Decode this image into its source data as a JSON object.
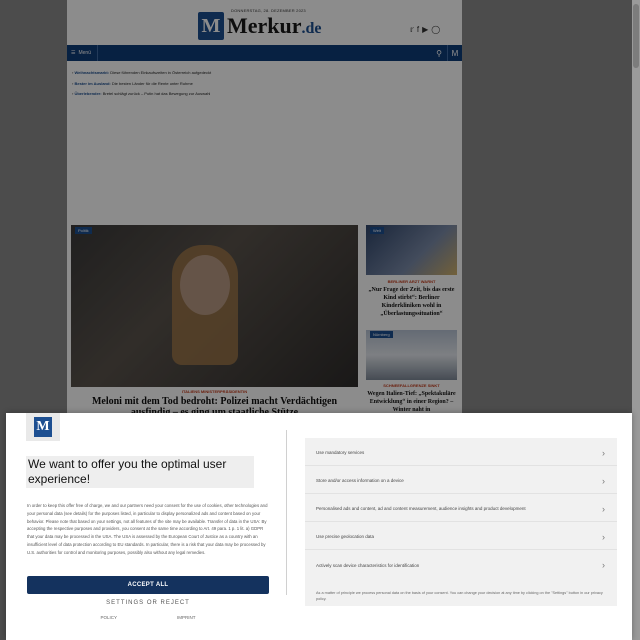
{
  "header": {
    "date": "DONNERSTAG, 28. DEZEMBER 2023",
    "logo_mark": "M",
    "logo_name": "Merkur",
    "logo_tld": ".de",
    "social_icons": [
      "twitter-icon",
      "facebook-icon",
      "youtube-icon",
      "instagram-icon"
    ]
  },
  "nav": {
    "menu_label": "Menü"
  },
  "tickers": [
    {
      "kicker": "Weihnachtsmarkt:",
      "text": "Diese führenden Einkaufszeiten in Österreich aufgedeckt"
    },
    {
      "kicker": "Bester im Ausland:",
      "text": "Die besten Länder für die Rente unter Ruhme"
    },
    {
      "kicker": "Überlebender:",
      "text": "Bretel schlägt zurück – Putin hat das Bewegung zur Auswahl"
    }
  ],
  "hero": {
    "tag": "Politik",
    "kicker": "ITALIENS MINISTERPRÄSIDENTIN",
    "title": "Meloni mit dem Tod bedroht: Polizei macht Verdächtigen ausfindig – es ging um staatliche Stütze"
  },
  "side_articles": [
    {
      "tag": "Welt",
      "kicker": "BERLINER ARZT WARNT",
      "title": "„Nur Frage der Zeit, bis das erste Kind stirbt“: Berliner Kinderkliniken wohl in „Überlastungssituation“"
    },
    {
      "tag": "Nürnberg",
      "kicker": "SCHNEEFALLGRENZE SINKT",
      "title": "Wegen Italien-Tief: „Spektakuläre Entwicklung“ in einer Region? – Winter naht in"
    }
  ],
  "consent": {
    "title": "We want to offer you the optimal user experience!",
    "body": "In order to keep this offer free of charge, we and our partners need your consent for the use of cookies, other technologies and your personal data (see details) for the purposes listed, in particular to display personalized ads and content based on your behavior. Please note that based on your settings, not all features of the site may be available. Transfer of data in the USA: By accepting the respective purposes and providers, you consent at the same time according to Art. 49 para. 1 p. 1 lit. a) GDPR that your data may be processed in the USA. The USA is assessed by the European Court of Justice as a country with an insufficient level of data protection according to EU standards. In particular, there is a risk that your data may be processed by U.S. authorities for control and monitoring purposes, possibly also without any legal remedies.",
    "accept_label": "ACCEPT ALL",
    "settings_label": "SETTINGS OR REJECT",
    "footer_links": [
      "POLICY",
      "IMPRINT"
    ],
    "purposes": [
      "Use mandatory services",
      "Store and/or access information on a device",
      "Personalised ads and content, ad and content measurement, audience insights and product development",
      "Use precise geolocation data",
      "Actively scan device characteristics for identification"
    ],
    "purpose_note": "As a matter of principle we process personal data on the basis of your consent. You can change your decision at any time by clicking on the \"Settings\" button in our privacy policy."
  },
  "colors": {
    "brand_blue": "#1d4f91",
    "nav_blue": "#0e3c78",
    "accept_button": "#14325e",
    "kicker_red": "#c23a1a"
  }
}
